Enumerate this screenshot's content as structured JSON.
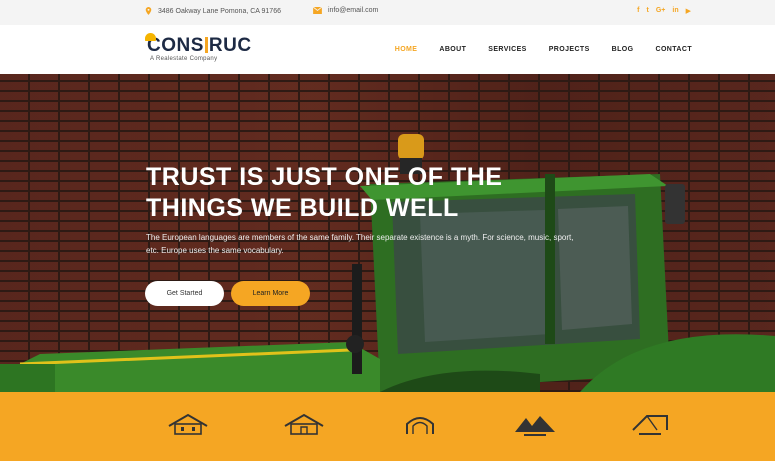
{
  "topbar": {
    "address": "3486 Oakway Lane Pomona, CA 91766",
    "email": "info@email.com",
    "socials": [
      "f",
      "t",
      "G+",
      "in",
      "▶"
    ]
  },
  "logo": {
    "name_left": "CONS",
    "name_right": "RUC",
    "tagline": "A Realestate Company"
  },
  "nav": {
    "items": [
      "HOME",
      "ABOUT",
      "SERVICES",
      "PROJECTS",
      "BLOG",
      "CONTACT"
    ],
    "active": "HOME"
  },
  "hero": {
    "title_line1": "TRUST IS JUST ONE OF THE",
    "title_line2": "THINGS WE BUILD WELL",
    "text": "The European languages are members of the same family. Their separate existence is a myth. For science, music, sport, etc. Europe uses the same vocabulary.",
    "btn_start": "Get Started",
    "btn_learn": "Learn More"
  },
  "partners": [
    "house-logo",
    "house-logo",
    "arch-logo",
    "mountain-logo",
    "roof-logo"
  ],
  "colors": {
    "accent": "#f5a623",
    "dark": "#1d2a44",
    "tractor_green": "#3a8a2a"
  }
}
